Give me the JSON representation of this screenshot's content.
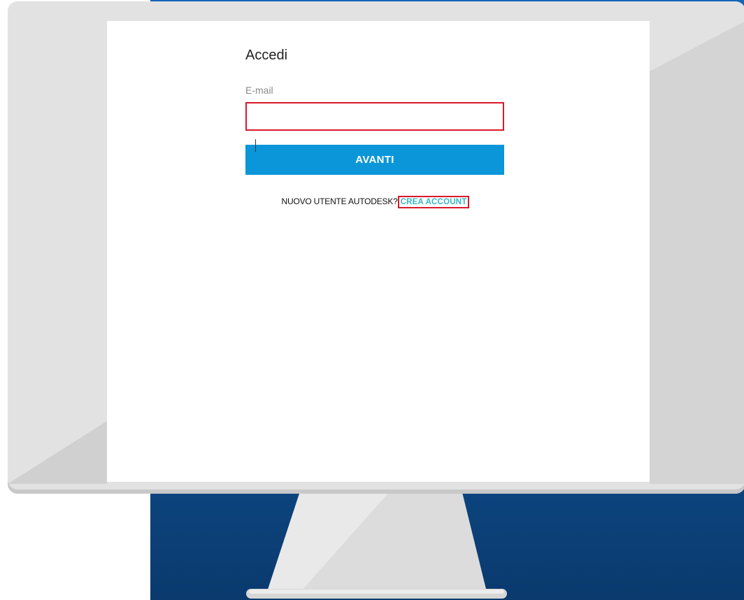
{
  "login": {
    "title": "Accedi",
    "email_label": "E-mail",
    "email_value": "",
    "submit_label": "AVANTI",
    "new_user_prompt": "NUOVO UTENTE AUTODESK?",
    "create_account_label": "CREA ACCOUNT"
  },
  "colors": {
    "accent": "#0a96d9",
    "highlight_border": "#d9182b",
    "link": "#37b5c6",
    "backdrop": "#0f4f8f",
    "monitor_bezel": "#e2e2e2"
  }
}
